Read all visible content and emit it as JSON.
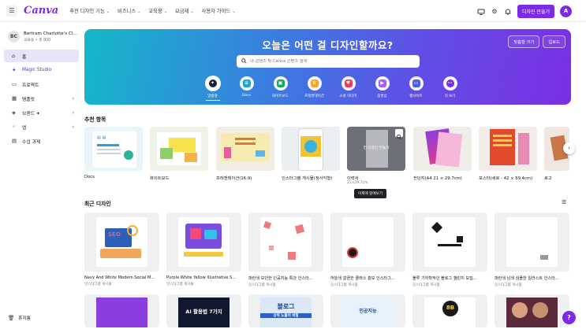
{
  "topbar": {
    "logo": "Canva",
    "nav": [
      {
        "label": "추천 디자인 기능"
      },
      {
        "label": "비즈니스"
      },
      {
        "label": "교육용"
      },
      {
        "label": "요금제"
      },
      {
        "label": "사용자 가이드"
      }
    ],
    "create_button": "디자인 만들기",
    "avatar_letter": "A"
  },
  "sidebar": {
    "account_initials": "BC",
    "account_name": "Bertram Charlotte's Cl...",
    "account_sub": "교육용 • 총 800",
    "items": [
      {
        "label": "홈",
        "icon": "home-icon"
      },
      {
        "label": "Magic Studio",
        "icon": "magic-icon"
      },
      {
        "label": "프로젝트",
        "icon": "folder-icon"
      },
      {
        "label": "템플릿",
        "icon": "template-icon"
      },
      {
        "label": "브랜드 ✦",
        "icon": "brand-icon"
      },
      {
        "label": "앱",
        "icon": "apps-icon"
      },
      {
        "label": "수업 과제",
        "icon": "assignment-icon"
      }
    ],
    "trash": "휴지통"
  },
  "hero": {
    "title": "오늘은 어떤 걸 디자인할까요?",
    "custom_size": "맞춤형 크기",
    "upload": "업로드",
    "search_placeholder": "내 콘텐츠 및 Canva 콘텐츠 검색",
    "shortcuts": [
      {
        "label": "맞춤형",
        "color": "#14233c"
      },
      {
        "label": "Docs",
        "color": "#1aa3d8"
      },
      {
        "label": "화이트보드",
        "color": "#18a860"
      },
      {
        "label": "프레젠테이션",
        "color": "#f5a623"
      },
      {
        "label": "소셜 미디어",
        "color": "#ee3b5c"
      },
      {
        "label": "동영상",
        "color": "#a85cf0"
      },
      {
        "label": "웹사이트",
        "color": "#4a5ce8"
      },
      {
        "label": "더 보기",
        "color": "#7d2ae8"
      }
    ]
  },
  "recommended": {
    "title": "추천 항목",
    "items": [
      {
        "label": "Docs",
        "sub": ""
      },
      {
        "label": "화이트보드",
        "sub": ""
      },
      {
        "label": "프레젠테이션(16:9)",
        "sub": ""
      },
      {
        "label": "인스타그램 게시물(정사각형)",
        "sub": ""
      },
      {
        "label": "이력서",
        "sub": "21×29.7cm"
      },
      {
        "label": "전단지(A4 21 × 29.7cm)",
        "sub": ""
      },
      {
        "label": "포스터(세로 - 42 × 59.4cm)",
        "sub": ""
      },
      {
        "label": "로고",
        "sub": ""
      }
    ],
    "resume_overlay": "헌 디자인 만들기",
    "tooltip": "이제에 앞에보기"
  },
  "recent": {
    "title": "최근 디자인",
    "row1": [
      {
        "title": "Navy And White Modern Social M...",
        "type": "인스타그램 게시물"
      },
      {
        "title": "Purple White Yellow Illustrative S...",
        "type": "인스타그램 게시물"
      },
      {
        "title": "파란색 모던한 인공지능 특강 인스타...",
        "type": "인스타그램 게시물"
      },
      {
        "title": "하늘색 깔끔한 클래스 홍보 인스타그...",
        "type": "인스타그램 게시물"
      },
      {
        "title": "블루 기하학적인 블로그 챌린지 모집...",
        "type": "인스타그램 게시물"
      },
      {
        "title": "파란색 남색 심플한 일러스트 인스타...",
        "type": "인스타그램 게시물"
      }
    ],
    "row2_texts": {
      "ai": "AI 활용법 7가지",
      "blog": "블로그",
      "blog_sub": "상위 노출의 비밀",
      "ai_course": "인공지능",
      "bb": "8B"
    }
  },
  "colors": {
    "accent": "#7d2ae8",
    "active_sidebar": "#e8e3f6"
  }
}
